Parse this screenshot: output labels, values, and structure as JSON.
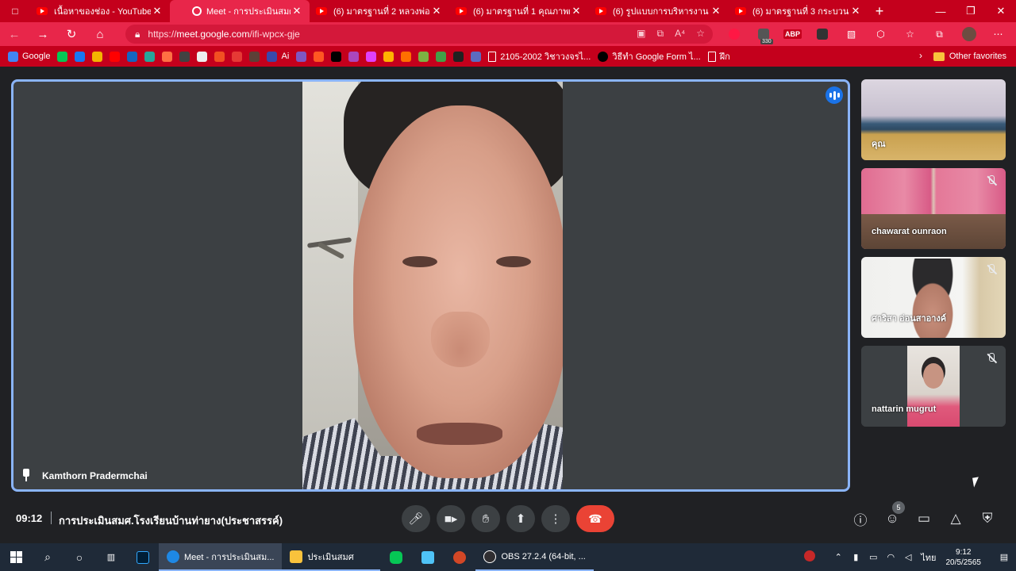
{
  "browser": {
    "tabs": [
      {
        "title": "เนื้อหาของช่อง - YouTube Stu",
        "favicon": "youtube-icon",
        "active": false
      },
      {
        "title": "Meet - การประเมินสมศ.โ",
        "favicon": "meet-icon",
        "active": true
      },
      {
        "title": "(6) มาตรฐานที่ 2 หลวงพ่อวัดท่",
        "favicon": "youtube-icon",
        "active": false
      },
      {
        "title": "(6) มาตรฐานที่ 1 คุณภาพผู้เรียน",
        "favicon": "youtube-icon",
        "active": false
      },
      {
        "title": "(6) รูปแบบการบริหารงาน โรงเรี",
        "favicon": "youtube-icon",
        "active": false
      },
      {
        "title": "(6) มาตรฐานที่ 3 กระบวนการ",
        "favicon": "youtube-icon",
        "active": false
      }
    ],
    "url_host": "meet.google.com",
    "url_scheme": "https://",
    "url_path": "/ifi-wpcx-gje",
    "extension_badge": "330",
    "extension_abp": "ABP",
    "bookmarks": [
      {
        "label": "Google",
        "color": "#4285f4"
      },
      {
        "label": "",
        "color": "#06c755"
      },
      {
        "label": "",
        "color": "#1877f2"
      },
      {
        "label": "",
        "color": "#f4b400"
      },
      {
        "label": "",
        "color": "#ff0000"
      },
      {
        "label": "",
        "color": "#1565c0"
      },
      {
        "label": "",
        "color": "#26a69a"
      },
      {
        "label": "",
        "color": "#ff7043"
      },
      {
        "label": "",
        "color": "#424242"
      },
      {
        "label": "",
        "color": "#eeeeee"
      },
      {
        "label": "",
        "color": "#f25022"
      },
      {
        "label": "",
        "color": "#e53935"
      },
      {
        "label": "",
        "color": "#5d4037"
      },
      {
        "label": "Ai",
        "color": "#3949ab"
      },
      {
        "label": "",
        "color": "#7e57c2"
      },
      {
        "label": "",
        "color": "#ff5722"
      },
      {
        "label": "",
        "color": "#000000"
      },
      {
        "label": "",
        "color": "#ab47bc"
      },
      {
        "label": "",
        "color": "#e040fb"
      },
      {
        "label": "",
        "color": "#ffb300"
      },
      {
        "label": "",
        "color": "#ff6f00"
      },
      {
        "label": "",
        "color": "#7cb342"
      },
      {
        "label": "",
        "color": "#43a047"
      },
      {
        "label": "",
        "color": "#212121"
      },
      {
        "label": "",
        "color": "#5c6bc0"
      }
    ],
    "bookmark_doc1": "2105-2002 วิชาวงจรไ...",
    "bookmark_form": "วิธีทำ Google Form ไ...",
    "bookmark_doc2": "ฝึก",
    "other_favorites": "Other favorites"
  },
  "meet": {
    "main_participant": "Kamthorn Pradermchai",
    "participants": [
      {
        "name": "คุณ",
        "muted": false
      },
      {
        "name": "chawarat ounraon",
        "muted": true
      },
      {
        "name": "ศาริสา อ่อนสาอางค์",
        "muted": true
      },
      {
        "name": "nattarin mugrut",
        "muted": true
      }
    ],
    "time": "09:12",
    "meeting_title": "การประเมินสมศ.โรงเรียนบ้านท่ายาง(ประชาสรรค์)",
    "people_count": "5",
    "colors": {
      "accent": "#8ab4f8",
      "end_call": "#ea4335",
      "speaking": "#1a73e8"
    }
  },
  "taskbar": {
    "apps": [
      {
        "label": "Meet - การประเมินสม...",
        "color": "#1e88e5",
        "state": "active"
      },
      {
        "label": "ประเมินสมศ",
        "color": "#f9c23c",
        "state": "open"
      },
      {
        "label": "OBS 27.2.4 (64-bit, ...",
        "color": "#302e31",
        "state": "open"
      }
    ],
    "language": "ไทย",
    "clock_time": "9:12",
    "clock_date": "20/5/2565"
  }
}
